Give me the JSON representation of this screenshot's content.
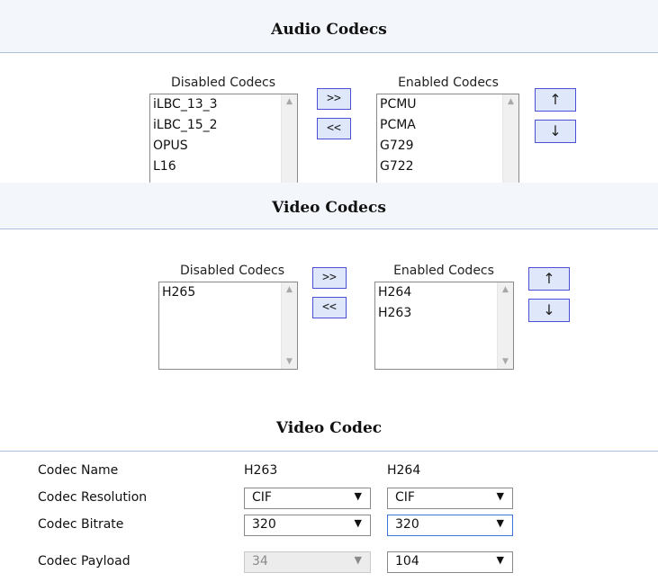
{
  "audio": {
    "title": "Audio Codecs",
    "disabled_label": "Disabled Codecs",
    "enabled_label": "Enabled Codecs",
    "disabled_items": [
      "iLBC_13_3",
      "iLBC_15_2",
      "OPUS",
      "L16"
    ],
    "enabled_items": [
      "PCMU",
      "PCMA",
      "G729",
      "G722"
    ],
    "move_right": ">>",
    "move_left": "<<",
    "move_up": "↑",
    "move_down": "↓"
  },
  "video": {
    "title": "Video Codecs",
    "disabled_label": "Disabled Codecs",
    "enabled_label": "Enabled Codecs",
    "disabled_items": [
      "H265"
    ],
    "enabled_items": [
      "H264",
      "H263"
    ],
    "move_right": ">>",
    "move_left": "<<",
    "move_up": "↑",
    "move_down": "↓"
  },
  "video_codec": {
    "title": "Video Codec",
    "rows": {
      "name": {
        "label": "Codec Name",
        "h263": "H263",
        "h264": "H264"
      },
      "resolution": {
        "label": "Codec Resolution",
        "h263": "CIF",
        "h264": "CIF"
      },
      "bitrate": {
        "label": "Codec Bitrate",
        "h263": "320",
        "h264": "320"
      },
      "payload": {
        "label": "Codec Payload",
        "h263": "34",
        "h264": "104"
      }
    }
  },
  "icons": {
    "dropdown": "▼",
    "scroll_up": "▲",
    "scroll_down": "▼"
  }
}
